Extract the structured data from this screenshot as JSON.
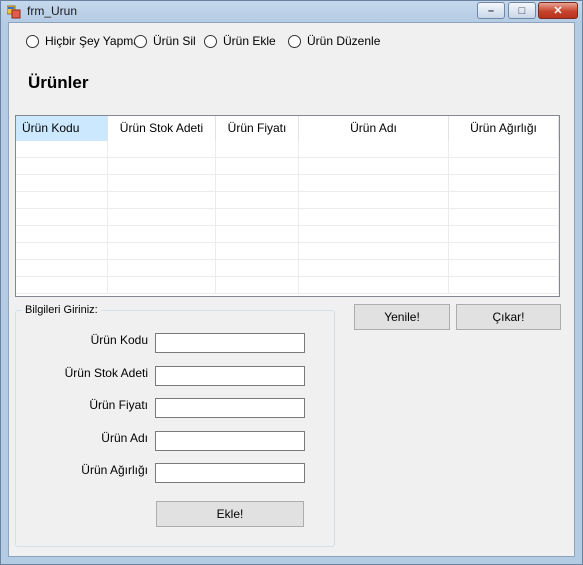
{
  "window": {
    "title": "frm_Urun"
  },
  "title_buttons": {
    "minimize": "–",
    "maximize": "□",
    "close": "✕"
  },
  "radio_options": [
    {
      "label": "Hiçbir Şey Yapma"
    },
    {
      "label": "Ürün Sil"
    },
    {
      "label": "Ürün Ekle"
    },
    {
      "label": "Ürün Düzenle"
    }
  ],
  "heading": "Ürünler",
  "grid": {
    "columns": [
      "Ürün Kodu",
      "Ürün Stok Adeti",
      "Ürün Fiyatı",
      "Ürün Adı",
      "Ürün Ağırlığı"
    ],
    "selected_column": "Ürün Kodu"
  },
  "form": {
    "group_title": "Bilgileri Giriniz:",
    "fields": [
      {
        "label": "Ürün Kodu",
        "value": ""
      },
      {
        "label": "Ürün Stok Adeti",
        "value": ""
      },
      {
        "label": "Ürün Fiyatı",
        "value": ""
      },
      {
        "label": "Ürün Adı",
        "value": ""
      },
      {
        "label": "Ürün Ağırlığı",
        "value": ""
      }
    ],
    "add_button": "Ekle!"
  },
  "actions": {
    "refresh_button": "Yenile!",
    "exit_button": "Çıkar!"
  },
  "icons": {
    "app": "app-icon"
  },
  "colors": {
    "title_bar": "#b4cbe4",
    "client_bg": "#f0f0f0",
    "selected_header": "#cce8ff",
    "close_button": "#c8432c"
  }
}
